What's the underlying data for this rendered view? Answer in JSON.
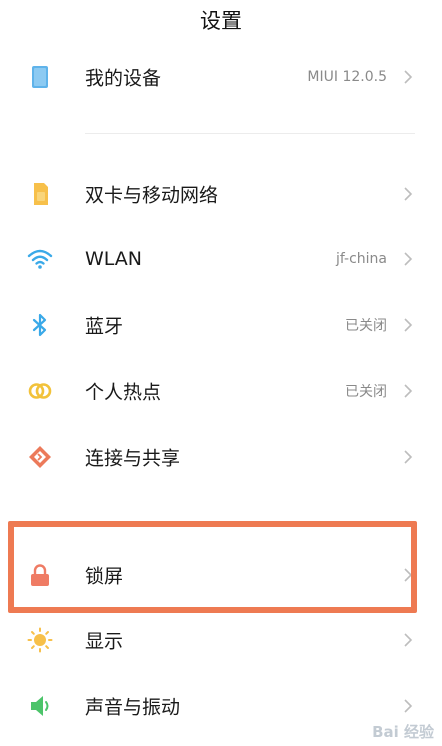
{
  "header": {
    "title": "设置"
  },
  "device": {
    "label": "我的设备",
    "value": "MIUI 12.0.5"
  },
  "network": [
    {
      "key": "sim",
      "label": "双卡与移动网络",
      "value": ""
    },
    {
      "key": "wlan",
      "label": "WLAN",
      "value": "jf-china"
    },
    {
      "key": "bluetooth",
      "label": "蓝牙",
      "value": "已关闭"
    },
    {
      "key": "hotspot",
      "label": "个人热点",
      "value": "已关闭"
    },
    {
      "key": "share",
      "label": "连接与共享",
      "value": ""
    }
  ],
  "system": [
    {
      "key": "lockscreen",
      "label": "锁屏",
      "value": ""
    },
    {
      "key": "display",
      "label": "显示",
      "value": ""
    },
    {
      "key": "sound",
      "label": "声音与振动",
      "value": ""
    }
  ],
  "watermark": "Bai 经验",
  "colors": {
    "highlight": "#ee7a52",
    "device_icon": "#5fb3ea",
    "sim_icon": "#f7c04a",
    "wlan_icon": "#3aa9e8",
    "bluetooth_icon": "#3aa9e8",
    "hotspot_icon": "#f2c23a",
    "share_icon": "#ec7a5a",
    "lock_icon": "#ef7b64",
    "display_icon": "#f7c04a",
    "sound_icon": "#4cc46a"
  }
}
